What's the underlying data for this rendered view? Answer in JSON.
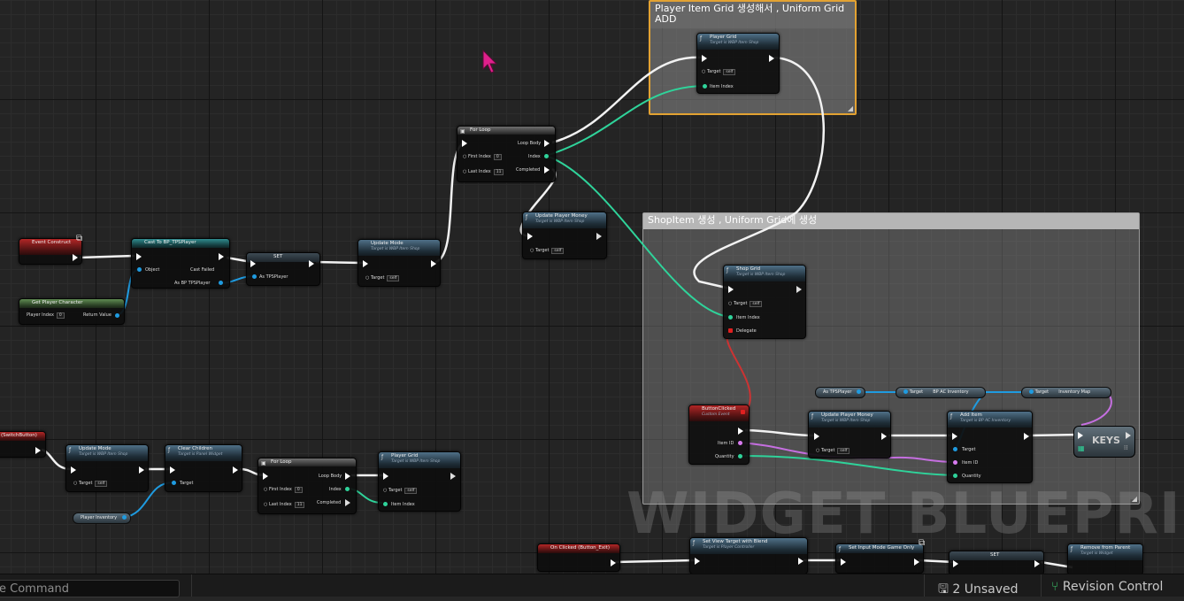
{
  "comments": {
    "player_grid": "Player Item Grid 생성해서 , Uniform Grid ADD",
    "shop_item": "ShopItem 생성 , Uniform Grid에 생성"
  },
  "watermark": "WIDGET BLUEPRINT",
  "nodes": {
    "event_construct": {
      "title": "Event Construct"
    },
    "get_player_character": {
      "title": "Get Player Character",
      "player_index_label": "Player Index",
      "player_index_value": "0",
      "return_label": "Return Value"
    },
    "cast_tps": {
      "title": "Cast To BP_TPSPlayer",
      "object_label": "Object",
      "cast_failed_label": "Cast Failed",
      "as_label": "As BP TPSPlayer"
    },
    "set_top": {
      "title": "SET",
      "as_label": "As TPSPlayer"
    },
    "update_mode_top": {
      "title": "Update Mode",
      "subtitle": "Target is WBP Item Shop",
      "target_label": "Target",
      "target_value": "self"
    },
    "for_loop_top": {
      "title": "For Loop",
      "loop_body": "Loop Body",
      "first_index": "First Index",
      "first_value": "0",
      "index": "Index",
      "last_index": "Last Index",
      "last_value": "11",
      "completed": "Completed"
    },
    "update_player_money_top": {
      "title": "Update Player Money",
      "subtitle": "Target is WBP Item Shop",
      "target_label": "Target",
      "target_value": "self"
    },
    "player_grid_top": {
      "title": "Player Grid",
      "subtitle": "Target is WBP Item Shop",
      "target_label": "Target",
      "target_value": "self",
      "item_index": "Item Index"
    },
    "shop_grid": {
      "title": "Shop Grid",
      "subtitle": "Target is WBP Item Shop",
      "target_label": "Target",
      "target_value": "self",
      "item_index": "Item Index",
      "delegate": "Delegate"
    },
    "as_tps_chip": "As TPSPlayer",
    "bp_ac_chip": {
      "target": "Target",
      "label": "BP AC Inventory"
    },
    "inv_map_chip": {
      "target": "Target",
      "label": "Inventory Map"
    },
    "button_clicked": {
      "title": "ButtonClicked",
      "subtitle": "Custom Event",
      "item_id": "Item ID",
      "quantity": "Quantity"
    },
    "update_player_money_mid": {
      "title": "Update Player Money",
      "subtitle": "Target is WBP Item Shop",
      "target_label": "Target",
      "target_value": "self"
    },
    "add_item": {
      "title": "Add Item",
      "subtitle": "Target is BP AC Inventory",
      "target": "Target",
      "item_id": "Item ID",
      "quantity": "Quantity"
    },
    "keys": "KEYS",
    "switch_event": "(SwitchButton)",
    "update_mode_bottom": {
      "title": "Update Mode",
      "subtitle": "Target is WBP Item Shop",
      "target_label": "Target",
      "target_value": "self"
    },
    "clear_children": {
      "title": "Clear Children",
      "subtitle": "Target is Panel Widget",
      "target_label": "Target"
    },
    "player_inventory_chip": "Player Inventory",
    "for_loop_bottom": {
      "title": "For Loop",
      "loop_body": "Loop Body",
      "first_index": "First Index",
      "first_value": "0",
      "index": "Index",
      "last_index": "Last Index",
      "last_value": "11",
      "completed": "Completed"
    },
    "player_grid_bottom": {
      "title": "Player Grid",
      "subtitle": "Target is WBP Item Shop",
      "target_label": "Target",
      "target_value": "self",
      "item_index": "Item Index"
    },
    "on_clicked_exit": {
      "title": "On Clicked (Button_Exit)"
    },
    "set_view_target": {
      "title": "Set View Target with Blend",
      "subtitle": "Target is Player Controller"
    },
    "set_input_mode": {
      "title": "Set Input Mode Game Only"
    },
    "set_bottom": {
      "title": "SET"
    },
    "remove_from_parent": {
      "title": "Remove from Parent",
      "subtitle": "Target is Widget"
    }
  },
  "statusbar": {
    "command_placeholder": "e Command",
    "unsaved": "2 Unsaved",
    "revision": "Revision Control"
  },
  "colors": {
    "exec": "#ffffff",
    "object": "#1f9be0",
    "integer": "#2fd39a",
    "name": "#d87bf0",
    "delegate": "#e02020",
    "comment_selected": "#e3a232"
  }
}
